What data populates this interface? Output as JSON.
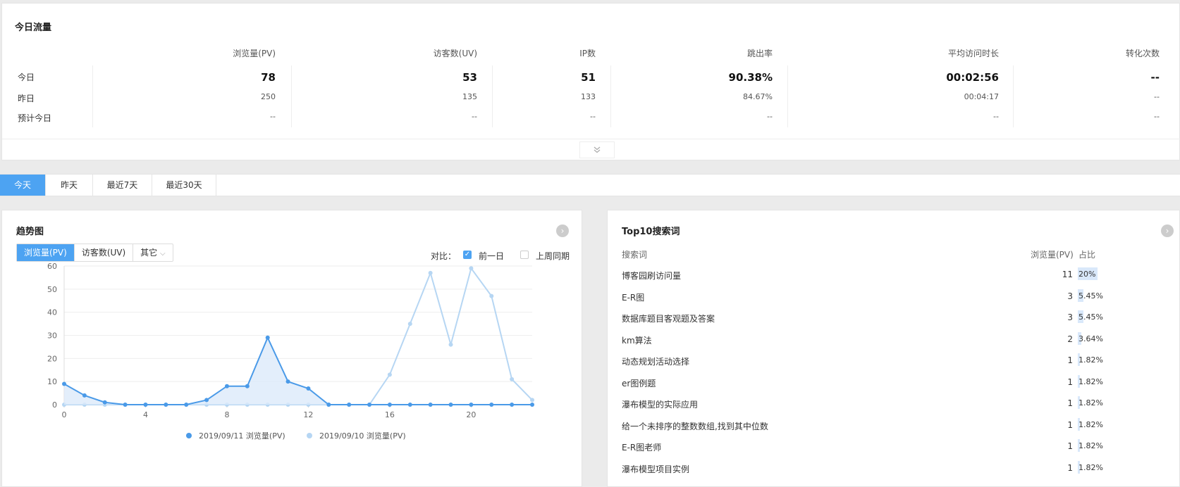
{
  "traffic": {
    "title": "今日流量",
    "row_labels": [
      "今日",
      "昨日",
      "预计今日"
    ],
    "columns": [
      {
        "header": "浏览量(PV)",
        "today": "78",
        "yesterday": "250",
        "forecast": "--"
      },
      {
        "header": "访客数(UV)",
        "today": "53",
        "yesterday": "135",
        "forecast": "--"
      },
      {
        "header": "IP数",
        "today": "51",
        "yesterday": "133",
        "forecast": "--"
      },
      {
        "header": "跳出率",
        "today": "90.38%",
        "yesterday": "84.67%",
        "forecast": "--"
      },
      {
        "header": "平均访问时长",
        "today": "00:02:56",
        "yesterday": "00:04:17",
        "forecast": "--"
      },
      {
        "header": "转化次数",
        "today": "--",
        "yesterday": "--",
        "forecast": "--"
      }
    ],
    "expand_icon": "double-chevron-down-icon"
  },
  "tabs": [
    {
      "label": "今天",
      "active": true
    },
    {
      "label": "昨天",
      "active": false
    },
    {
      "label": "最近7天",
      "active": false
    },
    {
      "label": "最近30天",
      "active": false
    }
  ],
  "trend": {
    "title": "趋势图",
    "metric_tabs": [
      "浏览量(PV)",
      "访客数(UV)",
      "其它"
    ],
    "compare_label": "对比：",
    "compare_options": [
      {
        "label": "前一日",
        "checked": true
      },
      {
        "label": "上周同期",
        "checked": false
      }
    ]
  },
  "chart_data": {
    "type": "line",
    "x": [
      0,
      1,
      2,
      3,
      4,
      5,
      6,
      7,
      8,
      9,
      10,
      11,
      12,
      13,
      14,
      15,
      16,
      17,
      18,
      19,
      20,
      21,
      22,
      23
    ],
    "xticks": [
      0,
      4,
      8,
      12,
      16,
      20
    ],
    "ylim": [
      0,
      60
    ],
    "yticks": [
      0,
      10,
      20,
      30,
      40,
      50,
      60
    ],
    "grid": true,
    "legend_position": "bottom",
    "series": [
      {
        "name": "2019/09/11 浏览量(PV)",
        "color": "#4a9ae8",
        "area": true,
        "values": [
          9,
          4,
          1,
          0,
          0,
          0,
          0,
          2,
          8,
          8,
          29,
          10,
          7,
          0,
          0,
          0,
          0,
          0,
          0,
          0,
          0,
          0,
          0,
          0
        ]
      },
      {
        "name": "2019/09/10 浏览量(PV)",
        "color": "#b6d6f3",
        "area": false,
        "values": [
          0,
          0,
          0,
          0,
          0,
          0,
          0,
          0,
          0,
          0,
          0,
          0,
          0,
          0,
          0,
          0,
          13,
          35,
          57,
          26,
          59,
          47,
          11,
          2
        ]
      }
    ]
  },
  "top10": {
    "title": "Top10搜索词",
    "headers": {
      "keyword": "搜索词",
      "pv": "浏览量(PV)",
      "share": "占比"
    },
    "rows": [
      {
        "keyword": "博客园刷访问量",
        "pv": "11",
        "share": "20%",
        "ratio": 0.2
      },
      {
        "keyword": "E-R图",
        "pv": "3",
        "share": "5.45%",
        "ratio": 0.0545
      },
      {
        "keyword": "数据库题目客观题及答案",
        "pv": "3",
        "share": "5.45%",
        "ratio": 0.0545
      },
      {
        "keyword": "km算法",
        "pv": "2",
        "share": "3.64%",
        "ratio": 0.0364
      },
      {
        "keyword": "动态规划活动选择",
        "pv": "1",
        "share": "1.82%",
        "ratio": 0.0182
      },
      {
        "keyword": "er图例题",
        "pv": "1",
        "share": "1.82%",
        "ratio": 0.0182
      },
      {
        "keyword": "瀑布模型的实际应用",
        "pv": "1",
        "share": "1.82%",
        "ratio": 0.0182
      },
      {
        "keyword": "给一个未排序的整数数组,找到其中位数",
        "pv": "1",
        "share": "1.82%",
        "ratio": 0.0182
      },
      {
        "keyword": "E-R图老师",
        "pv": "1",
        "share": "1.82%",
        "ratio": 0.0182
      },
      {
        "keyword": "瀑布模型项目实例",
        "pv": "1",
        "share": "1.82%",
        "ratio": 0.0182
      }
    ]
  }
}
